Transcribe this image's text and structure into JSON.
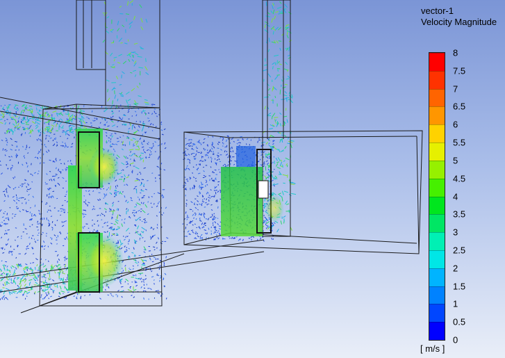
{
  "legend": {
    "title": "vector-1",
    "subtitle": "Velocity Magnitude",
    "units": "[ m/s ]",
    "ticks": [
      "8",
      "7.5",
      "7",
      "6.5",
      "6",
      "5.5",
      "5",
      "4.5",
      "4",
      "3.5",
      "3",
      "2.5",
      "2",
      "1.5",
      "1",
      "0.5",
      "0"
    ],
    "min": 0,
    "max": 8,
    "colors": [
      "#0000ff",
      "#0046ff",
      "#0082ff",
      "#00b4ff",
      "#00e6e6",
      "#00f0b4",
      "#00e664",
      "#00e61e",
      "#46f000",
      "#96f000",
      "#e6f000",
      "#ffd200",
      "#ff9600",
      "#ff6400",
      "#ff3200",
      "#ff0000"
    ]
  },
  "scene": {
    "background_top": "#7b95d6",
    "background_bottom": "#eef2fa",
    "outline_color": "#222222"
  }
}
